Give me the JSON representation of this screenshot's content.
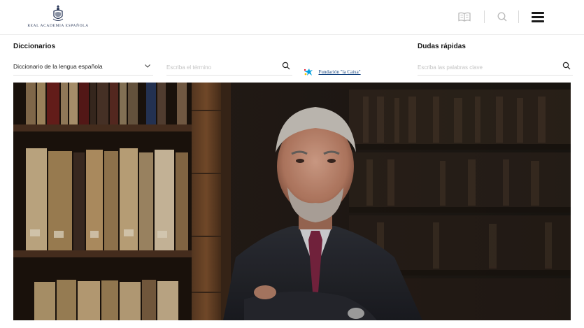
{
  "header": {
    "logo_text": "REAL ACADEMIA ESPAÑOLA",
    "icons": [
      "book-icon",
      "search-icon",
      "menu-icon"
    ]
  },
  "diccionarios": {
    "title": "Diccionarios",
    "selected_dictionary": "Diccionario de la lengua española",
    "search_placeholder": "Escriba el término"
  },
  "sponsor": {
    "text": "Fundación \"la Caixa\""
  },
  "dudas": {
    "title": "Dudas rápidas",
    "search_placeholder": "Escriba las palabras clave"
  },
  "colors": {
    "brand_navy": "#2c3a5a",
    "caixa_blue": "#0a3b7a",
    "caixa_star": "#00a0e0"
  }
}
